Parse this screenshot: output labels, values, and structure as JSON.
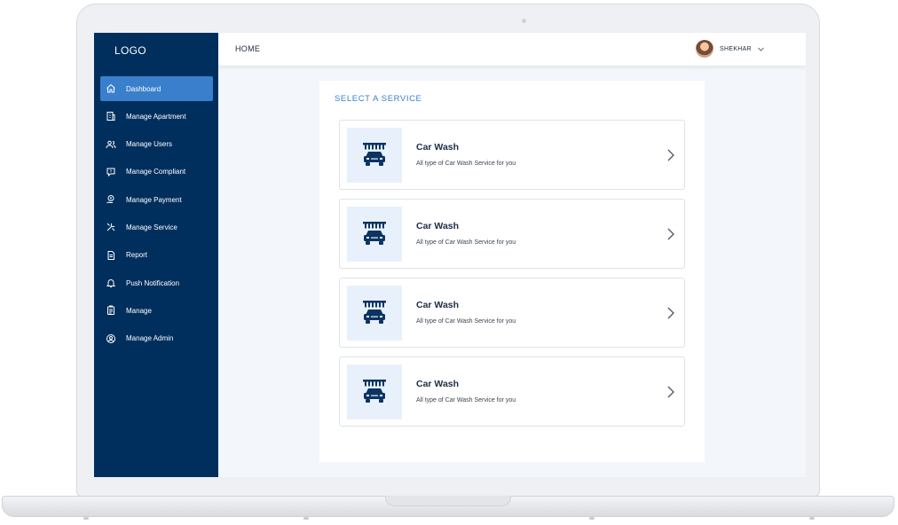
{
  "sidebar": {
    "logo": "LOGO",
    "items": [
      {
        "label": "Dashboard",
        "icon": "home-icon",
        "active": true
      },
      {
        "label": "Manage Apartment",
        "icon": "building-icon"
      },
      {
        "label": "Manage Users",
        "icon": "users-icon"
      },
      {
        "label": "Manage Compliant",
        "icon": "message-alert-icon"
      },
      {
        "label": "Manage Payment",
        "icon": "payment-icon"
      },
      {
        "label": "Manage Service",
        "icon": "tools-icon"
      },
      {
        "label": "Report",
        "icon": "document-icon"
      },
      {
        "label": "Push Notification",
        "icon": "bell-icon"
      },
      {
        "label": "Manage",
        "icon": "clipboard-icon"
      },
      {
        "label": "Manage Admin",
        "icon": "user-circle-icon"
      }
    ]
  },
  "header": {
    "breadcrumb": "HOME",
    "user_name": "SHEKHAR"
  },
  "main": {
    "title": "SELECT A SERVICE",
    "services": [
      {
        "title": "Car Wash",
        "description": "All type of Car Wash Service for you",
        "icon": "car-wash-icon"
      },
      {
        "title": "Car Wash",
        "description": "All type of Car Wash Service for you",
        "icon": "car-wash-icon"
      },
      {
        "title": "Car Wash",
        "description": "All type of Car Wash Service for you",
        "icon": "car-wash-icon"
      },
      {
        "title": "Car Wash",
        "description": "All type of Car Wash Service for you",
        "icon": "car-wash-icon"
      }
    ]
  },
  "colors": {
    "sidebar_bg": "#002f5d",
    "active_item": "#3a7fcc",
    "accent": "#3a7fcc",
    "icon_bg": "#e8f1fb"
  }
}
